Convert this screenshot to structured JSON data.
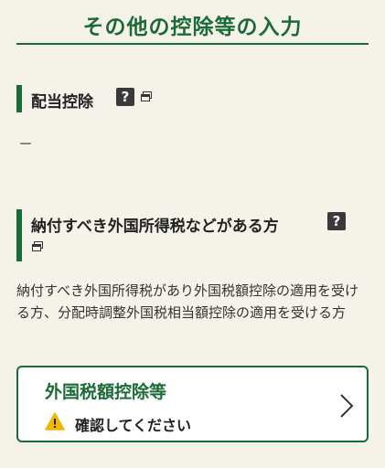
{
  "page": {
    "title": "その他の控除等の入力"
  },
  "dividend_section": {
    "heading": "配当控除",
    "help_icon_glyph": "?",
    "value": "－"
  },
  "foreign_tax_section": {
    "heading": "納付すべき外国所得税などがある方",
    "help_icon_glyph": "?",
    "description": "納付すべき外国所得税があり外国税額控除の適用を受ける方、分配時調整外国税相当額控除の適用を受ける方",
    "card": {
      "title": "外国税額控除等",
      "status": "確認してください",
      "status_icon": "warning-icon"
    }
  },
  "colors": {
    "accent_green": "#1a6b35",
    "background": "#f5f2ea",
    "warning_yellow": "#f2b705"
  }
}
